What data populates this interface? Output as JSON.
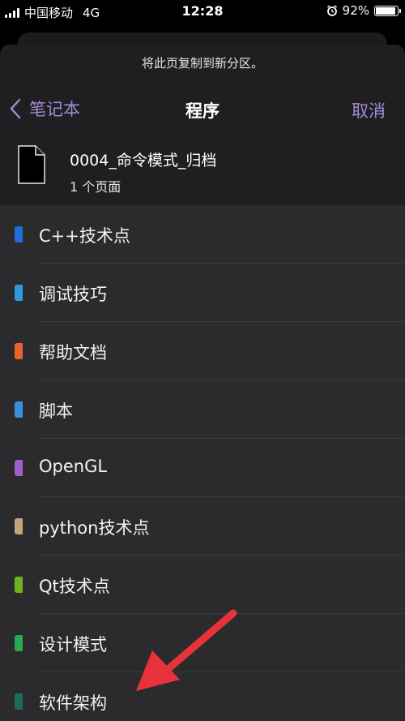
{
  "status_bar": {
    "carrier": "中国移动",
    "network": "4G",
    "time": "12:28",
    "battery": "92%",
    "battery_level": 0.92
  },
  "sheet": {
    "hint": "将此页复制到新分区。",
    "back_label": "笔记本",
    "title": "程序",
    "cancel_label": "取消"
  },
  "page_info": {
    "name": "0004_命令模式_归档",
    "count": "1 个页面"
  },
  "sections": [
    {
      "label": "C++技术点",
      "color": "#1e6fd9"
    },
    {
      "label": "调试技巧",
      "color": "#2a9bd6"
    },
    {
      "label": "帮助文档",
      "color": "#e8642a"
    },
    {
      "label": "脚本",
      "color": "#3b8fe0"
    },
    {
      "label": "OpenGL",
      "color": "#9b5fc9"
    },
    {
      "label": "python技术点",
      "color": "#c9a27c"
    },
    {
      "label": "Qt技术点",
      "color": "#6fb31f"
    },
    {
      "label": "设计模式",
      "color": "#2aa84f"
    },
    {
      "label": "软件架构",
      "color": "#1f6b5a"
    }
  ],
  "icons": {
    "back": "chevron-left-icon",
    "document": "document-icon",
    "alarm": "alarm-icon",
    "signal": "signal-icon",
    "battery": "battery-icon"
  },
  "colors": {
    "accent": "#a38ad6",
    "annotation_arrow": "#e8323a"
  }
}
